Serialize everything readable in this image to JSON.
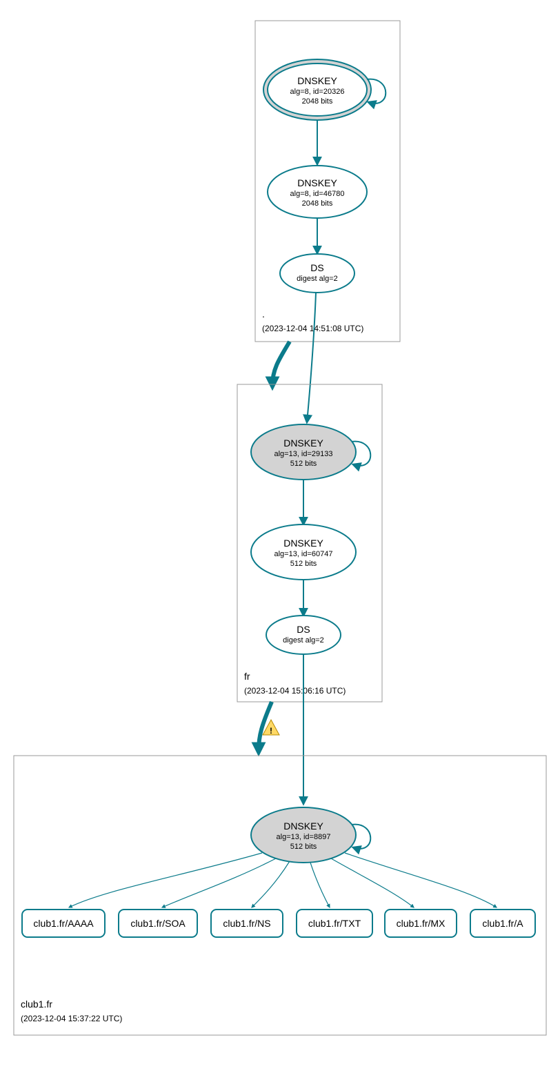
{
  "zones": {
    "root": {
      "label": ".",
      "timestamp": "(2023-12-04 14:51:08 UTC)",
      "ksk": {
        "title": "DNSKEY",
        "sub1": "alg=8, id=20326",
        "sub2": "2048 bits"
      },
      "zsk": {
        "title": "DNSKEY",
        "sub1": "alg=8, id=46780",
        "sub2": "2048 bits"
      },
      "ds": {
        "title": "DS",
        "sub1": "digest alg=2"
      }
    },
    "fr": {
      "label": "fr",
      "timestamp": "(2023-12-04 15:06:16 UTC)",
      "ksk": {
        "title": "DNSKEY",
        "sub1": "alg=13, id=29133",
        "sub2": "512 bits"
      },
      "zsk": {
        "title": "DNSKEY",
        "sub1": "alg=13, id=60747",
        "sub2": "512 bits"
      },
      "ds": {
        "title": "DS",
        "sub1": "digest alg=2"
      }
    },
    "club1": {
      "label": "club1.fr",
      "timestamp": "(2023-12-04 15:37:22 UTC)",
      "ksk": {
        "title": "DNSKEY",
        "sub1": "alg=13, id=8897",
        "sub2": "512 bits"
      },
      "records": {
        "aaaa": "club1.fr/AAAA",
        "soa": "club1.fr/SOA",
        "ns": "club1.fr/NS",
        "txt": "club1.fr/TXT",
        "mx": "club1.fr/MX",
        "a": "club1.fr/A"
      }
    }
  },
  "warning_icon": "!"
}
